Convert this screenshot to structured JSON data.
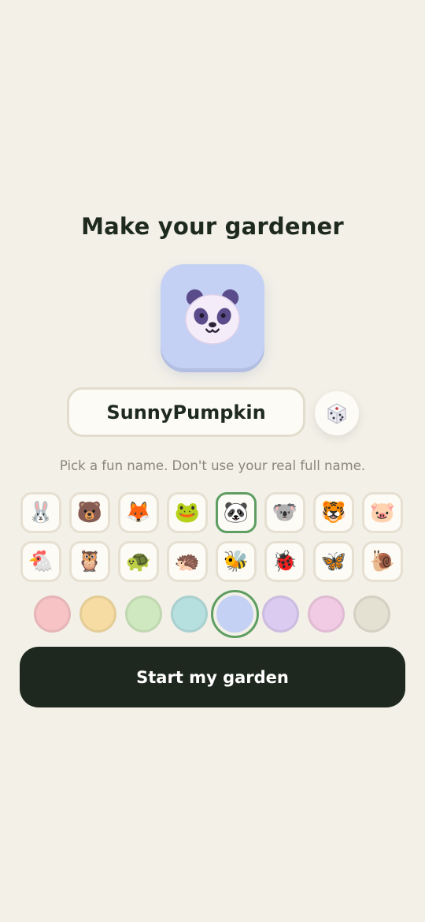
{
  "title": "Make your gardener",
  "avatar": {
    "animal": "panda",
    "background": "#c4d1f4"
  },
  "name_field": {
    "value": "SunnyPumpkin"
  },
  "dice_button": {
    "icon": "dice-icon"
  },
  "hint": "Pick a fun name. Don't use your real full name.",
  "animals": [
    {
      "name": "rabbit",
      "glyph": "🐰",
      "selected": false
    },
    {
      "name": "bear",
      "glyph": "🐻",
      "selected": false
    },
    {
      "name": "fox",
      "glyph": "🦊",
      "selected": false
    },
    {
      "name": "frog",
      "glyph": "🐸",
      "selected": false
    },
    {
      "name": "panda",
      "glyph": "🐼",
      "selected": true
    },
    {
      "name": "koala",
      "glyph": "🐨",
      "selected": false
    },
    {
      "name": "tiger",
      "glyph": "🐯",
      "selected": false
    },
    {
      "name": "pig",
      "glyph": "🐷",
      "selected": false
    },
    {
      "name": "chicken",
      "glyph": "🐔",
      "selected": false
    },
    {
      "name": "owl",
      "glyph": "🦉",
      "selected": false
    },
    {
      "name": "turtle",
      "glyph": "🐢",
      "selected": false
    },
    {
      "name": "hedgehog",
      "glyph": "🦔",
      "selected": false
    },
    {
      "name": "bee",
      "glyph": "🐝",
      "selected": false
    },
    {
      "name": "ladybug",
      "glyph": "🐞",
      "selected": false
    },
    {
      "name": "butterfly",
      "glyph": "🦋",
      "selected": false
    },
    {
      "name": "snail",
      "glyph": "🐌",
      "selected": false
    }
  ],
  "colors": [
    {
      "name": "pink",
      "hex": "#f7c3c5",
      "selected": false
    },
    {
      "name": "yellow",
      "hex": "#f6dca2",
      "selected": false
    },
    {
      "name": "green",
      "hex": "#cfe8bf",
      "selected": false
    },
    {
      "name": "teal",
      "hex": "#b6e0df",
      "selected": false
    },
    {
      "name": "blue",
      "hex": "#c4d1f4",
      "selected": true
    },
    {
      "name": "lavender",
      "hex": "#dccbf1",
      "selected": false
    },
    {
      "name": "rose",
      "hex": "#f1cbe4",
      "selected": false
    },
    {
      "name": "stone",
      "hex": "#e5e1d2",
      "selected": false
    }
  ],
  "start_button": {
    "label": "Start my garden"
  },
  "colors_theme": {
    "accent": "#5f9e62",
    "button_bg": "#1f281f",
    "page_bg": "#f3f0e8"
  }
}
